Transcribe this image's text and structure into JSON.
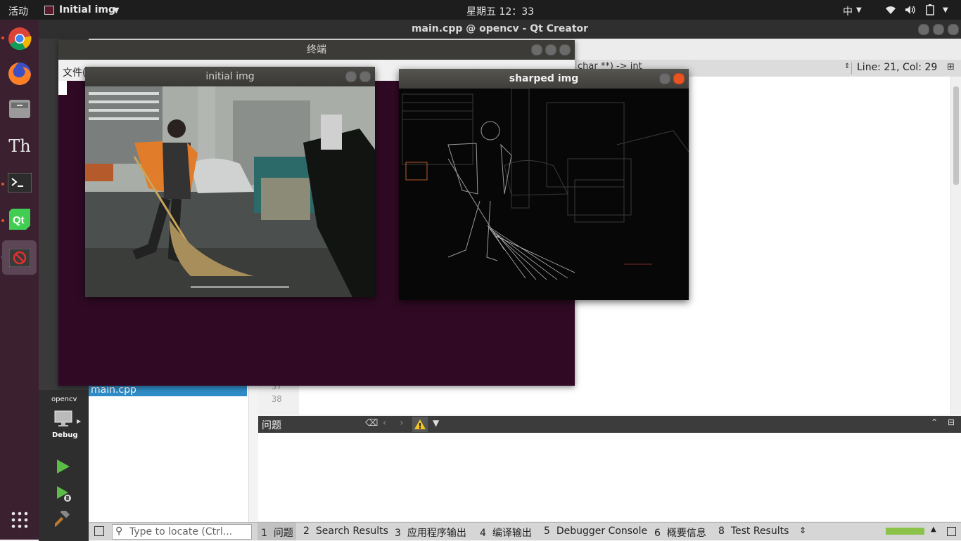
{
  "topbar": {
    "activities": "活动",
    "app_menu": "Initial img",
    "clock": "星期五 12：33",
    "input_method": "中"
  },
  "dock": {
    "items": [
      "chrome-icon",
      "firefox-icon",
      "files-icon",
      "fonts-icon",
      "terminal-icon",
      "qt-creator-icon",
      "initial-img-app-icon",
      "show-apps-icon"
    ]
  },
  "qt": {
    "title": "main.cpp @ opencv - Qt Creator",
    "menu_first": "文",
    "editor_bar_text": "char **) -> int",
    "line_col": "Line: 21, Col: 29",
    "line_numbers": [
      "37",
      "38"
    ],
    "project_file": "main.cpp",
    "kit": {
      "project": "opencv",
      "mode": "Debug"
    },
    "issues_title": "问题",
    "locate_placeholder": "Type to locate (Ctrl...",
    "status_tabs": [
      {
        "num": "1",
        "label": "问题"
      },
      {
        "num": "2",
        "label": "Search Results"
      },
      {
        "num": "3",
        "label": "应用程序输出"
      },
      {
        "num": "4",
        "label": "编译输出"
      },
      {
        "num": "5",
        "label": "Debugger Console"
      },
      {
        "num": "6",
        "label": "概要信息"
      },
      {
        "num": "8",
        "label": "Test Results"
      }
    ],
    "progress_color": "#8bc34a"
  },
  "terminal": {
    "title": "终端",
    "menu_first": "文件("
  },
  "windows": {
    "initial": {
      "title": "initial img"
    },
    "sharped": {
      "title": "sharped img"
    }
  },
  "colors": {
    "ubuntu_orange": "#e95420",
    "terminal_bg": "#300a24",
    "dock_bg": "#3b2030"
  }
}
